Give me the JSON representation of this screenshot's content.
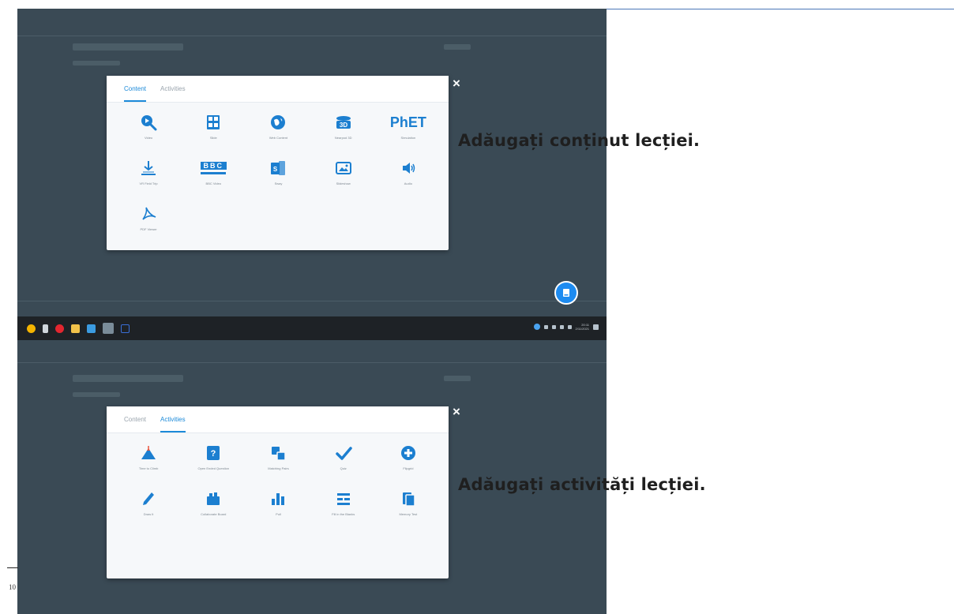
{
  "captions": {
    "content": "Adăugați conținut lecției.",
    "activities": "Adăugați activități lecției."
  },
  "dialog_content": {
    "tabs": [
      {
        "label": "Content",
        "active": true
      },
      {
        "label": "Activities",
        "active": false
      }
    ],
    "close_label": "×",
    "items": [
      {
        "label": "Video",
        "icon": "video-search-icon"
      },
      {
        "label": "Slide",
        "icon": "slide-icon"
      },
      {
        "label": "Web Content",
        "icon": "globe-icon"
      },
      {
        "label": "Nearpod 3D",
        "icon": "3d-icon"
      },
      {
        "label": "Simulation",
        "icon": "phet-icon",
        "text": "PhET"
      },
      {
        "label": "VR Field Trip",
        "icon": "field-trip-icon"
      },
      {
        "label": "BBC Video",
        "icon": "bbc-icon",
        "text": "BBC"
      },
      {
        "label": "Sway",
        "icon": "sway-icon"
      },
      {
        "label": "Slideshow",
        "icon": "slideshow-icon"
      },
      {
        "label": "Audio",
        "icon": "audio-icon"
      },
      {
        "label": "PDF Viewer",
        "icon": "pdf-icon"
      }
    ]
  },
  "dialog_activities": {
    "tabs": [
      {
        "label": "Content",
        "active": false
      },
      {
        "label": "Activities",
        "active": true
      }
    ],
    "close_label": "×",
    "items": [
      {
        "label": "Time to Climb",
        "icon": "mountain-icon"
      },
      {
        "label": "Open Ended Question",
        "icon": "question-icon"
      },
      {
        "label": "Matching Pairs",
        "icon": "matching-icon"
      },
      {
        "label": "Quiz",
        "icon": "check-icon"
      },
      {
        "label": "Flipgrid",
        "icon": "flipgrid-icon"
      },
      {
        "label": "Draw It",
        "icon": "pencil-icon"
      },
      {
        "label": "Collaborate Board",
        "icon": "board-icon"
      },
      {
        "label": "Poll",
        "icon": "poll-icon"
      },
      {
        "label": "Fill in the Blanks",
        "icon": "fill-blanks-icon"
      },
      {
        "label": "Memory Test",
        "icon": "memory-icon"
      }
    ]
  },
  "taskbar": {
    "icons": [
      {
        "name": "chrome-icon",
        "color": "#f4b400"
      },
      {
        "name": "file-icon",
        "color": "#cfd6dc"
      },
      {
        "name": "opera-icon",
        "color": "#e3262f"
      },
      {
        "name": "folder-icon",
        "color": "#f2c24a"
      },
      {
        "name": "monitor-icon",
        "color": "#3b9be0"
      },
      {
        "name": "app-icon",
        "color": "#7a8c99"
      },
      {
        "name": "terminal-icon",
        "color": "#3a6fd8"
      }
    ],
    "clock_time": "20:11",
    "clock_date": "2/11/2021"
  },
  "page_number": "10"
}
